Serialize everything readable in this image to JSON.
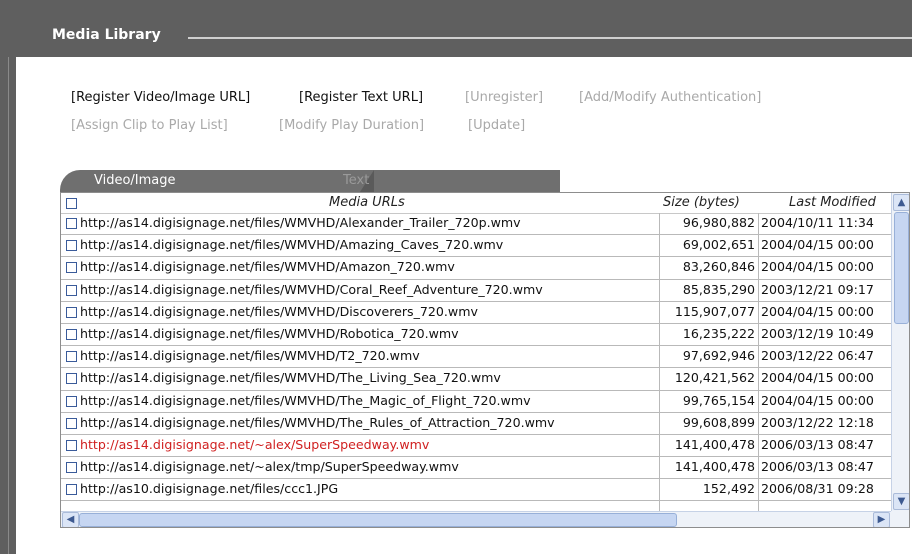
{
  "header": {
    "title": "Media Library"
  },
  "actions": [
    {
      "label": "[Register Video/Image URL]",
      "enabled": true
    },
    {
      "label": "[Register Text URL]",
      "enabled": true
    },
    {
      "label": "[Unregister]",
      "enabled": false
    },
    {
      "label": "[Add/Modify Authentication]",
      "enabled": false
    },
    {
      "label": "[Assign Clip to Play List]",
      "enabled": false
    },
    {
      "label": "[Modify Play Duration]",
      "enabled": false
    },
    {
      "label": "[Update]",
      "enabled": false
    }
  ],
  "tabs": [
    {
      "label": "Video/Image",
      "active": true
    },
    {
      "label": "Text",
      "active": false
    }
  ],
  "table": {
    "columns": [
      "Media URLs",
      "Size (bytes)",
      "Last Modified"
    ],
    "rows": [
      {
        "url": "http://as14.digisignage.net/files/WMVHD/Alexander_Trailer_720p.wmv",
        "size": "96,980,882",
        "modified": "2004/10/11 11:34"
      },
      {
        "url": "http://as14.digisignage.net/files/WMVHD/Amazing_Caves_720.wmv",
        "size": "69,002,651",
        "modified": "2004/04/15 00:00"
      },
      {
        "url": "http://as14.digisignage.net/files/WMVHD/Amazon_720.wmv",
        "size": "83,260,846",
        "modified": "2004/04/15 00:00"
      },
      {
        "url": "http://as14.digisignage.net/files/WMVHD/Coral_Reef_Adventure_720.wmv",
        "size": "85,835,290",
        "modified": "2003/12/21 09:17"
      },
      {
        "url": "http://as14.digisignage.net/files/WMVHD/Discoverers_720.wmv",
        "size": "115,907,077",
        "modified": "2004/04/15 00:00"
      },
      {
        "url": "http://as14.digisignage.net/files/WMVHD/Robotica_720.wmv",
        "size": "16,235,222",
        "modified": "2003/12/19 10:49"
      },
      {
        "url": "http://as14.digisignage.net/files/WMVHD/T2_720.wmv",
        "size": "97,692,946",
        "modified": "2003/12/22 06:47"
      },
      {
        "url": "http://as14.digisignage.net/files/WMVHD/The_Living_Sea_720.wmv",
        "size": "120,421,562",
        "modified": "2004/04/15 00:00"
      },
      {
        "url": "http://as14.digisignage.net/files/WMVHD/The_Magic_of_Flight_720.wmv",
        "size": "99,765,154",
        "modified": "2004/04/15 00:00"
      },
      {
        "url": "http://as14.digisignage.net/files/WMVHD/The_Rules_of_Attraction_720.wmv",
        "size": "99,608,899",
        "modified": "2003/12/22 12:18"
      },
      {
        "url": "http://as14.digisignage.net/~alex/SuperSpeedway.wmv",
        "size": "141,400,478",
        "modified": "2006/03/13 08:47",
        "highlight": true
      },
      {
        "url": "http://as14.digisignage.net/~alex/tmp/SuperSpeedway.wmv",
        "size": "141,400,478",
        "modified": "2006/03/13 08:47"
      },
      {
        "url": "http://as10.digisignage.net/files/ccc1.JPG",
        "size": "152,492",
        "modified": "2006/08/31 09:28"
      }
    ]
  },
  "colors": {
    "highlight_text": "#d02020",
    "header_bg": "#5f5f5f",
    "tab_bg": "#6f6f6f"
  },
  "scrollbar_icons": {
    "up": "scroll-up-arrow-icon",
    "down": "scroll-down-arrow-icon",
    "left": "scroll-left-arrow-icon",
    "right": "scroll-right-arrow-icon"
  }
}
